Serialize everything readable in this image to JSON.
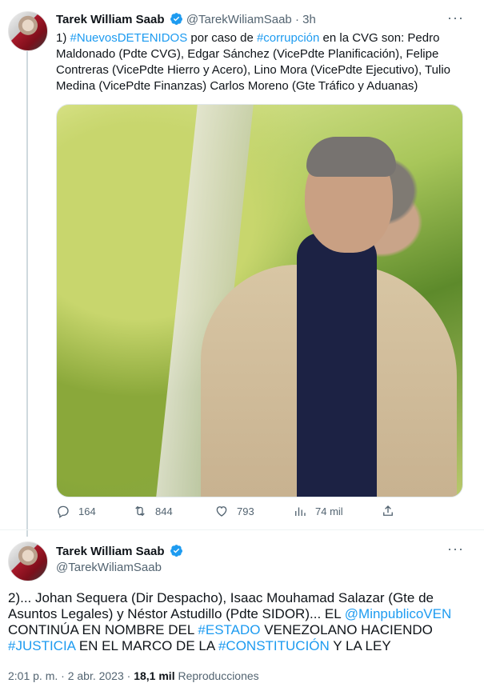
{
  "tweet1": {
    "author_name": "Tarek William Saab",
    "handle": "@TarekWiliamSaab",
    "time_sep": "·",
    "time": "3h",
    "text_parts": [
      {
        "t": "1) ",
        "link": false
      },
      {
        "t": "#NuevosDETENIDOS",
        "link": true
      },
      {
        "t": " por caso de ",
        "link": false
      },
      {
        "t": "#corrupción",
        "link": true
      },
      {
        "t": " en la CVG son: Pedro Maldonado (Pdte CVG), Edgar Sánchez (VicePdte Planificación), Felipe Contreras (VicePdte Hierro y Acero), Lino Mora (VicePdte Ejecutivo), Tulio Medina (VicePdte Finanzas) Carlos Moreno (Gte Tráfico y Aduanas)",
        "link": false
      }
    ],
    "stats": {
      "replies": "164",
      "retweets": "844",
      "likes": "793",
      "views": "74 mil"
    }
  },
  "tweet2": {
    "author_name": "Tarek William Saab",
    "handle": "@TarekWiliamSaab",
    "text_parts": [
      {
        "t": "2)... Johan Sequera (Dir Despacho), Isaac Mouhamad Salazar (Gte de Asuntos Legales) y Néstor Astudillo (Pdte SIDOR)... EL ",
        "link": false
      },
      {
        "t": "@MinpublicoVEN",
        "link": true
      },
      {
        "t": " CONTINÚA EN NOMBRE DEL ",
        "link": false
      },
      {
        "t": "#ESTADO",
        "link": true
      },
      {
        "t": " VENEZOLANO HACIENDO ",
        "link": false
      },
      {
        "t": "#JUSTICIA",
        "link": true
      },
      {
        "t": " EN EL MARCO DE LA ",
        "link": false
      },
      {
        "t": "#CONSTITUCIÓN",
        "link": true
      },
      {
        "t": " Y LA LEY",
        "link": false
      }
    ],
    "timestamp": "2:01 p. m. · 2 abr. 2023",
    "dot": "·",
    "views_count": "18,1 mil",
    "views_label": "Reproducciones"
  },
  "icons": {
    "more": "more-icon",
    "verified": "verified-badge-icon",
    "reply": "reply-icon",
    "retweet": "retweet-icon",
    "like": "like-icon",
    "views": "views-icon",
    "share": "share-icon"
  },
  "colors": {
    "accent": "#1d9bf0",
    "text": "#0f1419",
    "muted": "#536471"
  }
}
